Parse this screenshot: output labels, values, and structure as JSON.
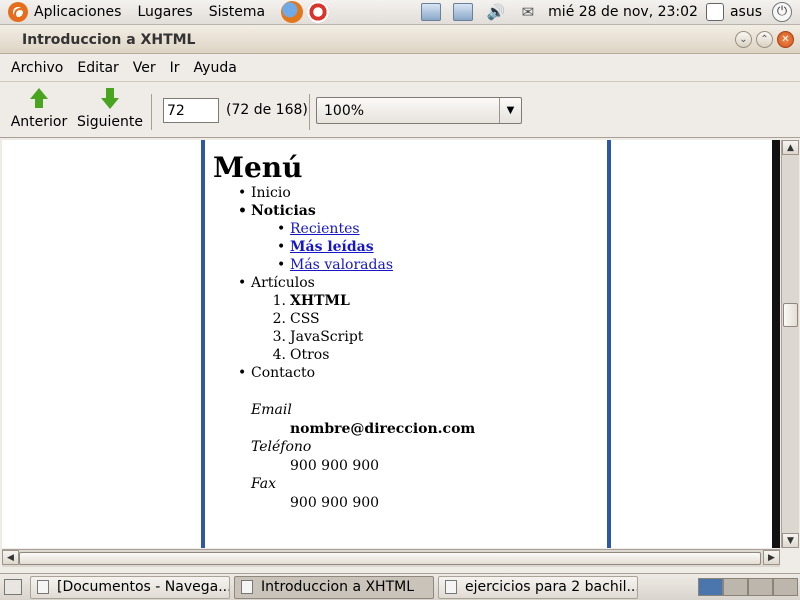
{
  "top_panel": {
    "menus": [
      "Aplicaciones",
      "Lugares",
      "Sistema"
    ],
    "clock": "mié 28 de nov, 23:02",
    "user": "asus"
  },
  "window": {
    "title": "Introduccion a XHTML",
    "menubar": [
      "Archivo",
      "Editar",
      "Ver",
      "Ir",
      "Ayuda"
    ]
  },
  "toolbar": {
    "back_label": "Anterior",
    "next_label": "Siguiente",
    "page_value": "72",
    "page_count": "(72 de 168)",
    "zoom": "100%"
  },
  "document": {
    "heading": "Menú",
    "items": {
      "inicio": "Inicio",
      "noticias": "Noticias",
      "noticias_sub": [
        "Recientes",
        "Más leídas",
        "Más valoradas"
      ],
      "articulos": "Artículos",
      "articulos_sub": [
        "XHTML",
        "CSS",
        "JavaScript",
        "Otros"
      ],
      "contacto": "Contacto"
    },
    "contact": {
      "email_label": "Email",
      "email_value": "nombre@direccion.com",
      "phone_label": "Teléfono",
      "phone_value": "900 900 900",
      "fax_label": "Fax",
      "fax_value": "900 900 900"
    }
  },
  "taskbar": {
    "tasks": [
      "[Documentos - Navega...",
      "Introduccion a XHTML",
      "ejercicios para 2 bachil..."
    ]
  }
}
